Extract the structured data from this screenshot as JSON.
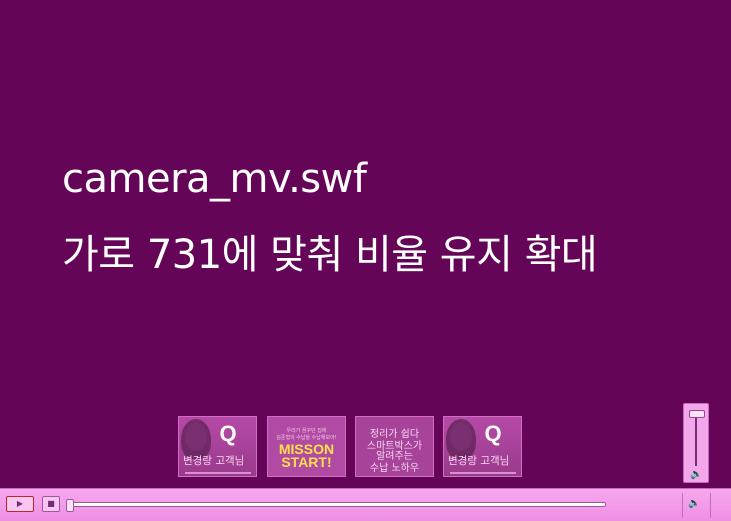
{
  "stage": {
    "title_line1": "camera_mv.swf",
    "title_line2": "가로 731에 맞춰 비율 유지 확대",
    "background_color": "#650558",
    "text_color": "#ffffff"
  },
  "thumbnails": [
    {
      "type": "person",
      "badge": "Q",
      "caption": "변경랑 고객님"
    },
    {
      "type": "mission",
      "small_line1": "우리가 꿈꾸던 집에",
      "small_line2": "김준형의 수납을 수납해보아!",
      "big_line1": "MISSON",
      "big_line2": "START!"
    },
    {
      "type": "text",
      "line1": "정리가 쉽다",
      "line2": "스마트박스가",
      "line3": "알려주는",
      "line4": "수납 노하우"
    },
    {
      "type": "person",
      "badge": "Q",
      "caption": "변경랑 고객님"
    }
  ],
  "controls": {
    "play_icon": "▶",
    "stop_icon": "■",
    "volume_icon": "🔈",
    "progress": 0.0,
    "volume_level": 1.0
  },
  "colors": {
    "controlbar": "#f29ee8",
    "accent": "#c0262c"
  }
}
